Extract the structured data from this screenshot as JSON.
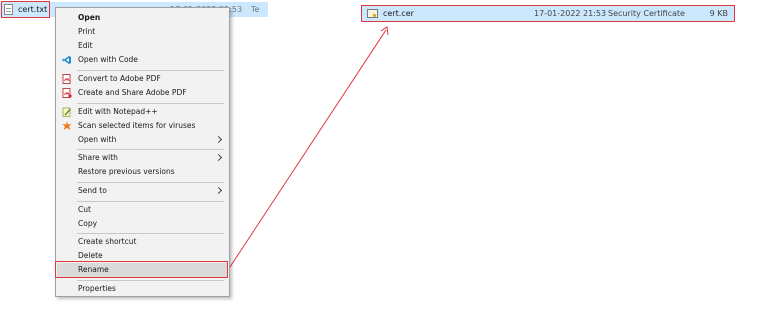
{
  "left_file": {
    "name": "cert.txt",
    "date": "17-01-2022 21:53",
    "type": "Te"
  },
  "right_file": {
    "name": "cert.cer",
    "date": "17-01-2022 21:53",
    "type": "Security Certificate",
    "size": "9 KB"
  },
  "context_menu": {
    "items": [
      {
        "label": "Open",
        "bold": true
      },
      {
        "label": "Print"
      },
      {
        "label": "Edit"
      },
      {
        "label": "Open with Code",
        "icon": "vscode-icon"
      },
      {
        "label": "Convert to Adobe PDF",
        "icon": "adobe-pdf-icon"
      },
      {
        "label": "Create and Share Adobe PDF",
        "icon": "adobe-pdf-share-icon"
      },
      {
        "label": "Edit with Notepad++",
        "icon": "notepad-plus-plus-icon"
      },
      {
        "label": "Scan selected items for viruses",
        "icon": "avast-scan-icon"
      },
      {
        "label": "Open with",
        "submenu": true
      },
      {
        "label": "Share with",
        "submenu": true
      },
      {
        "label": "Restore previous versions"
      },
      {
        "label": "Send to",
        "submenu": true
      },
      {
        "label": "Cut"
      },
      {
        "label": "Copy"
      },
      {
        "label": "Create shortcut"
      },
      {
        "label": "Delete"
      },
      {
        "label": "Rename",
        "highlighted": true
      },
      {
        "label": "Properties"
      }
    ]
  },
  "colors": {
    "selection": "#cce8ff",
    "annotation_red": "#e0383e",
    "menu_background": "#f2f2f2",
    "menu_hover": "#dadada"
  }
}
